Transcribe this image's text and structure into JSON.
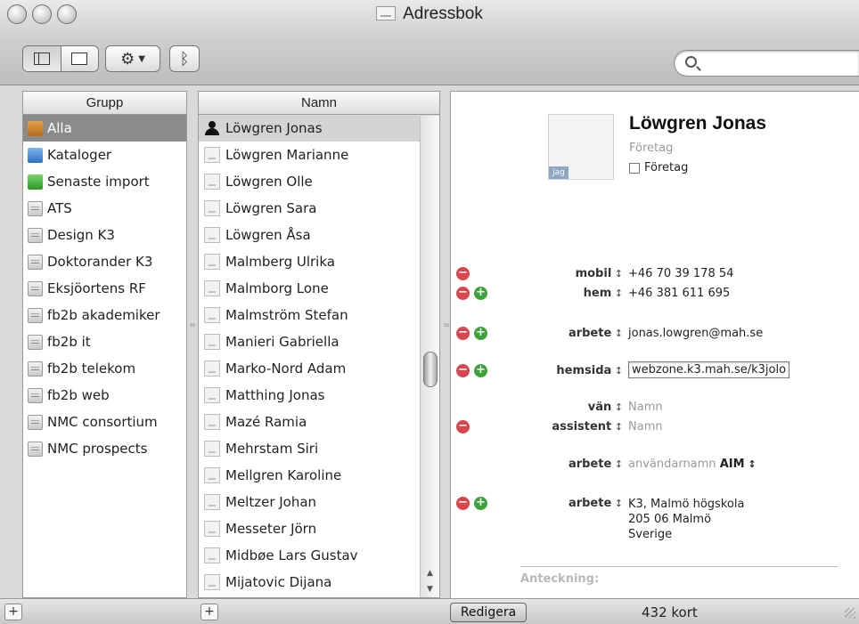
{
  "window": {
    "title": "Adressbok"
  },
  "toolbar": {
    "search_placeholder": ""
  },
  "groups": {
    "header": "Grupp",
    "items": [
      {
        "label": "Alla",
        "icon": "all"
      },
      {
        "label": "Kataloger",
        "icon": "dir"
      },
      {
        "label": "Senaste import",
        "icon": "recent"
      },
      {
        "label": "ATS",
        "icon": "group"
      },
      {
        "label": "Design K3",
        "icon": "group"
      },
      {
        "label": "Doktorander K3",
        "icon": "group"
      },
      {
        "label": "Eksjöortens RF",
        "icon": "group"
      },
      {
        "label": "fb2b akademiker",
        "icon": "group"
      },
      {
        "label": "fb2b it",
        "icon": "group"
      },
      {
        "label": "fb2b telekom",
        "icon": "group"
      },
      {
        "label": "fb2b web",
        "icon": "group"
      },
      {
        "label": "NMC consortium",
        "icon": "group"
      },
      {
        "label": "NMC prospects",
        "icon": "group"
      }
    ]
  },
  "names": {
    "header": "Namn",
    "items": [
      "Löwgren Jonas",
      "Löwgren Marianne",
      "Löwgren Olle",
      "Löwgren Sara",
      "Löwgren Åsa",
      "Malmberg Ulrika",
      "Malmborg Lone",
      "Malmström Stefan",
      "Manieri Gabriella",
      "Marko-Nord Adam",
      "Matthing Jonas",
      "Mazé Ramia",
      "Mehrstam Siri",
      "Mellgren Karoline",
      "Meltzer Johan",
      "Messeter Jörn",
      "Midbøe Lars Gustav",
      "Mijatovic Dijana"
    ]
  },
  "card": {
    "name": "Löwgren Jonas",
    "company_placeholder": "Företag",
    "company_checkbox_label": "Företag",
    "photo_badge": "jag",
    "fields": {
      "mobil": {
        "label": "mobil",
        "value": "+46 70 39 178 54"
      },
      "hem": {
        "label": "hem",
        "value": "+46 381 611 695"
      },
      "email": {
        "label": "arbete",
        "value": "jonas.lowgren@mah.se"
      },
      "web": {
        "label": "hemsida",
        "value": "webzone.k3.mah.se/k3jolo"
      },
      "van": {
        "label": "vän",
        "value": "Namn"
      },
      "assistent": {
        "label": "assistent",
        "value": "Namn"
      },
      "im": {
        "label": "arbete",
        "value": "användarnamn",
        "service": "AIM"
      },
      "address": {
        "label": "arbete",
        "line1": "K3, Malmö högskola",
        "line2": "205 06 Malmö",
        "line3": "Sverige"
      }
    },
    "note_label": "Anteckning:"
  },
  "bottom": {
    "add_symbol": "+",
    "edit_label": "Redigera",
    "count": "432 kort"
  }
}
